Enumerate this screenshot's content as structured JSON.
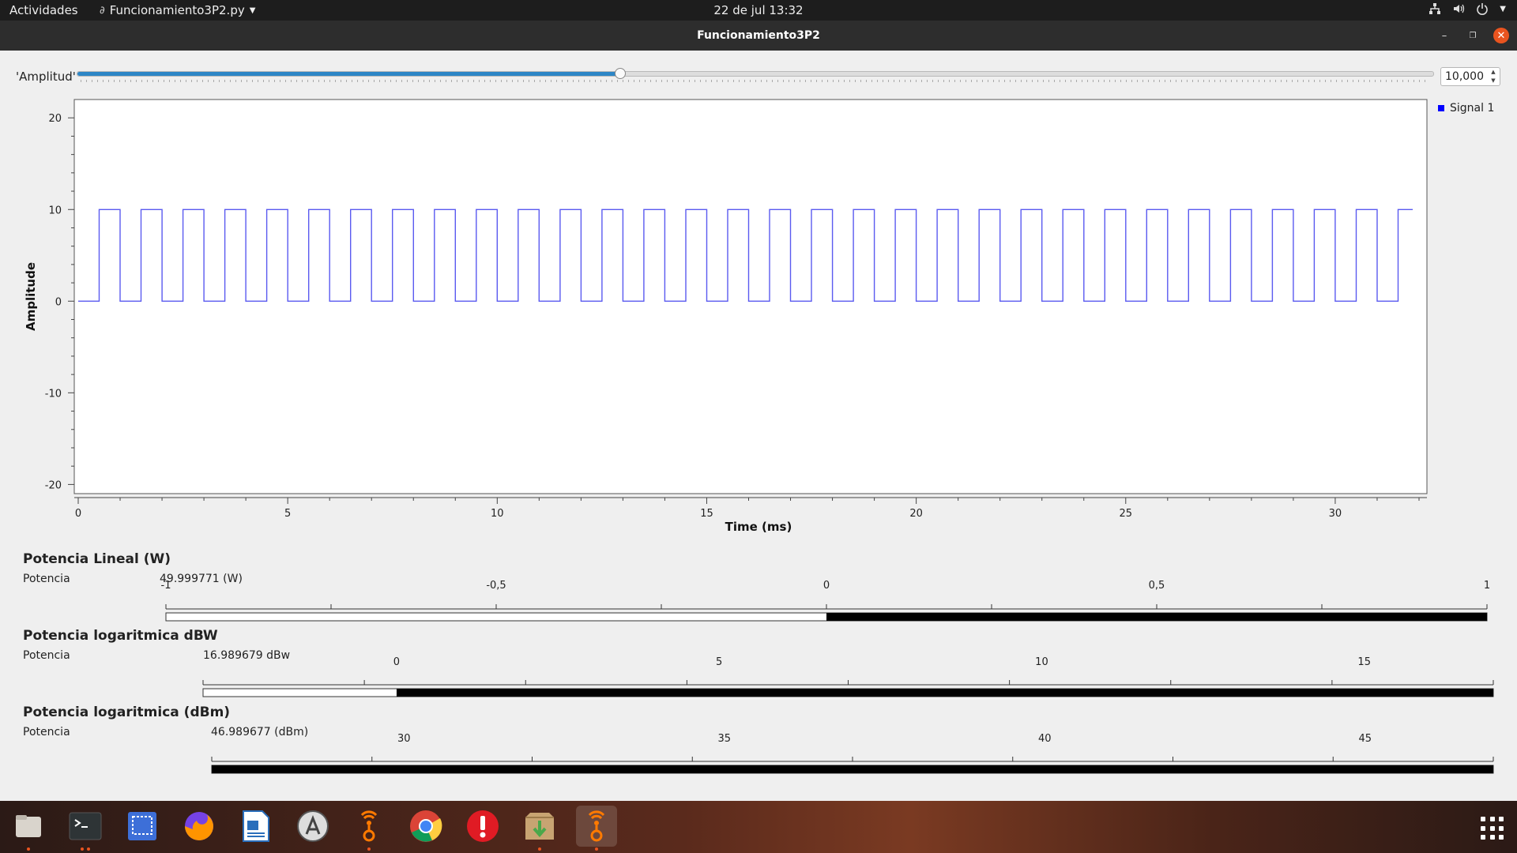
{
  "topbar": {
    "activities": "Actividades",
    "app_menu": "Funcionamiento3P2.py",
    "clock": "22 de jul  13:32"
  },
  "window": {
    "title": "Funcionamiento3P2"
  },
  "amplitude_control": {
    "label": "'Amplitud'",
    "value": "10,000",
    "slider_fraction": 0.4
  },
  "chart_data": {
    "type": "line",
    "xlabel": "Time (ms)",
    "ylabel": "Amplitude",
    "xlim": [
      0,
      32
    ],
    "ylim": [
      -21,
      22
    ],
    "x_ticks": [
      "0",
      "5",
      "10",
      "15",
      "20",
      "25",
      "30"
    ],
    "y_ticks": [
      "20",
      "10",
      "0",
      "-10",
      "-20"
    ],
    "legend_position": "top-right",
    "series": [
      {
        "name": "Signal 1",
        "color": "#5a5af0",
        "waveform": "square",
        "low": 0,
        "high": 10,
        "period_ms": 1.0,
        "first_rise_ms": 0.5,
        "duty": 0.5
      }
    ]
  },
  "meters": [
    {
      "title": "Potencia Lineal (W)",
      "label": "Potencia",
      "value": "49.999771 (W)",
      "ticks": [
        "-1",
        "-0,5",
        "0",
        "0,5",
        "1"
      ],
      "range": [
        -1,
        1
      ],
      "fill_from": 0
    },
    {
      "title": "Potencia logaritmica dBW",
      "label": "Potencia",
      "value": "16.989679 dBw",
      "ticks": [
        "0",
        "5",
        "10",
        "15"
      ],
      "range": [
        -3,
        17
      ],
      "fill_from": 0
    },
    {
      "title": "Potencia logaritmica (dBm)",
      "label": "Potencia",
      "value": "46.989677 (dBm)",
      "ticks": [
        "30",
        "35",
        "40",
        "45"
      ],
      "range": [
        27,
        47
      ],
      "fill_from": 27
    }
  ],
  "dock": {
    "items": [
      "files-icon",
      "terminal-icon",
      "screenshot-icon",
      "firefox-icon",
      "writer-icon",
      "software-icon",
      "gnuradio-icon",
      "chrome-icon",
      "error-report-icon",
      "archive-icon",
      "gnuradio-icon"
    ],
    "active_index": 10
  },
  "colors": {
    "accent": "#2d86c6",
    "signal": "#5a5af0",
    "close": "#e9541f"
  }
}
